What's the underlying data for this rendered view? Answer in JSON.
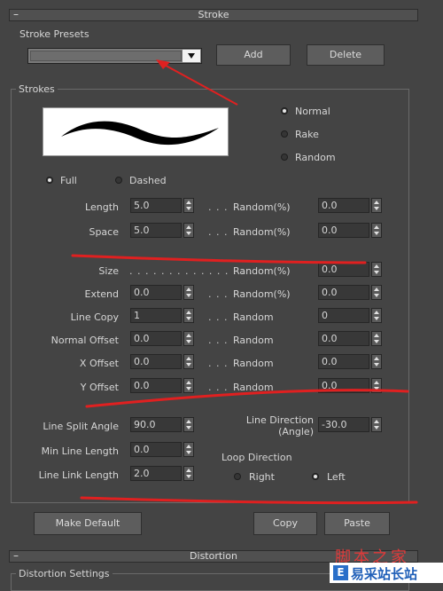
{
  "stroke_rollout": {
    "title": "Stroke",
    "collapse": "–"
  },
  "presets": {
    "group_label": "Stroke Presets",
    "dropdown_value": "",
    "add_label": "Add",
    "delete_label": "Delete"
  },
  "strokes": {
    "group_label": "Strokes",
    "style_options": {
      "normal": "Normal",
      "rake": "Rake",
      "random": "Random",
      "selected": "Normal"
    },
    "line_type": {
      "full": "Full",
      "dashed": "Dashed",
      "selected": "Full"
    },
    "dots": ". . .",
    "size_dots": ". . . . . . . . . . . . . . . .",
    "rows": {
      "length": {
        "label": "Length",
        "value": "5.0",
        "random_label": "Random(%)",
        "random_value": "0.0"
      },
      "space": {
        "label": "Space",
        "value": "5.0",
        "random_label": "Random(%)",
        "random_value": "0.0"
      },
      "size": {
        "label": "Size",
        "random_label": "Random(%)",
        "random_value": "0.0"
      },
      "extend": {
        "label": "Extend",
        "value": "0.0",
        "random_label": "Random(%)",
        "random_value": "0.0"
      },
      "line_copy": {
        "label": "Line Copy",
        "value": "1",
        "random_label": "Random",
        "random_value": "0"
      },
      "normal_offset": {
        "label": "Normal Offset",
        "value": "0.0",
        "random_label": "Random",
        "random_value": "0.0"
      },
      "x_offset": {
        "label": "X Offset",
        "value": "0.0",
        "random_label": "Random",
        "random_value": "0.0"
      },
      "y_offset": {
        "label": "Y Offset",
        "value": "0.0",
        "random_label": "Random",
        "random_value": "0.0"
      }
    },
    "line_split_angle": {
      "label": "Line Split Angle",
      "value": "90.0"
    },
    "min_line_length": {
      "label": "Min Line Length",
      "value": "0.0"
    },
    "line_link_length": {
      "label": "Line Link Length",
      "value": "2.0"
    },
    "line_direction": {
      "label_line1": "Line Direction",
      "label_line2": "(Angle)",
      "value": "-30.0"
    },
    "loop_direction": {
      "label": "Loop Direction",
      "right": "Right",
      "left": "Left",
      "selected": "Left"
    }
  },
  "footer": {
    "make_default": "Make Default",
    "copy": "Copy",
    "paste": "Paste"
  },
  "distortion_rollout": {
    "title": "Distortion",
    "collapse": "–",
    "settings_label": "Distortion Settings"
  },
  "watermark": {
    "top_text": "脚本之家",
    "logo_letter": "E",
    "site_name": "易采站长站"
  },
  "colors": {
    "panel_bg": "#444444",
    "annotation": "#e02020"
  }
}
